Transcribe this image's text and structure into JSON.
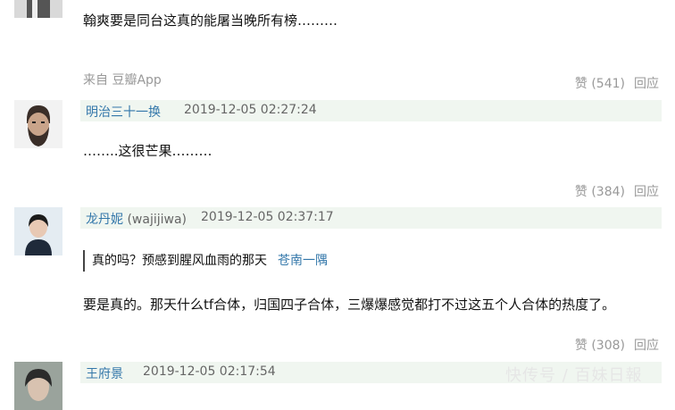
{
  "comments": [
    {
      "author": "",
      "time": "",
      "text": "翰爽要是同台这真的能屠当晚所有榜………",
      "source": "来自 豆瓣App",
      "likes": "赞 (541)",
      "reply": "回应"
    },
    {
      "author": "明治三十一换",
      "time": "2019-12-05 02:27:24",
      "text": "……..这很芒果………",
      "likes": "赞 (384)",
      "reply": "回应"
    },
    {
      "author": "龙丹妮",
      "handle": "(wajijiwa)",
      "time": "2019-12-05 02:37:17",
      "quote_text": "真的吗？预感到腥风血雨的那天",
      "quote_author": "苍南一隅",
      "text": "要是真的。那天什么tf合体，归国四子合体，三爆爆感觉都打不过这五个人合体的热度了。",
      "likes": "赞 (308)",
      "reply": "回应"
    },
    {
      "author": "王府景",
      "time": "2019-12-05 02:17:54"
    }
  ],
  "watermark": "快传号 / 百妹日報"
}
